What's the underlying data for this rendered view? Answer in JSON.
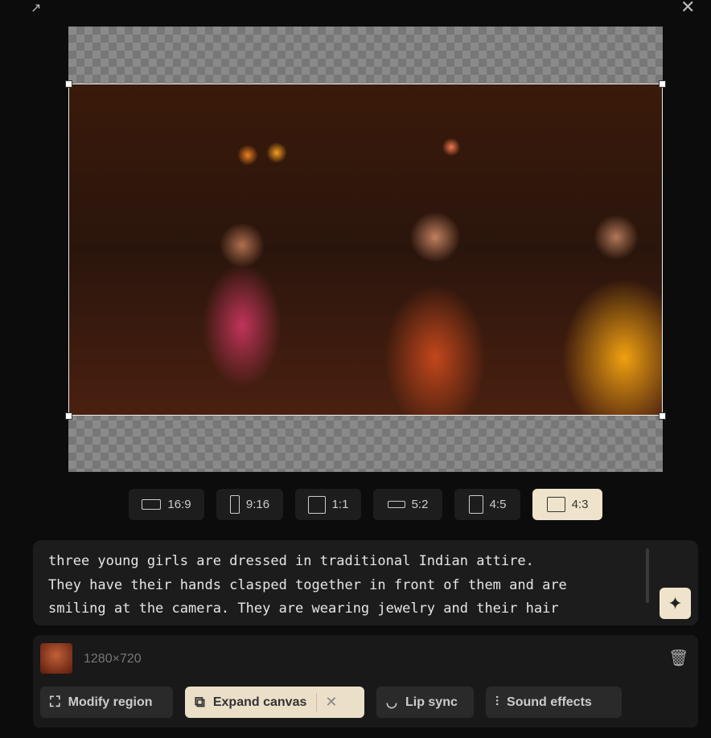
{
  "window": {
    "collapse_icon": "collapse-arrows-icon",
    "close_icon": "close-icon"
  },
  "aspect_ratios": [
    {
      "label": "16:9",
      "active": false
    },
    {
      "label": "9:16",
      "active": false
    },
    {
      "label": "1:1",
      "active": false
    },
    {
      "label": "5:2",
      "active": false
    },
    {
      "label": "4:5",
      "active": false
    },
    {
      "label": "4:3",
      "active": true
    }
  ],
  "prompt": {
    "text": "three young girls are dressed in traditional Indian attire.\nThey have their hands clasped together in front of them and are\nsmiling at the camera. They are wearing jewelry and their hair",
    "enhance_icon": "sparkle-icon"
  },
  "media": {
    "dimensions": "1280×720",
    "delete_icon": "trash-icon"
  },
  "tools": [
    {
      "label": "Modify region",
      "icon": "region-select-icon"
    },
    {
      "label": "Expand canvas",
      "icon": "expand-icon",
      "active": true
    },
    {
      "label": "Lip sync",
      "icon": "lips-icon"
    },
    {
      "label": "Sound effects",
      "icon": "sound-wave-icon"
    }
  ],
  "colors": {
    "accent": "#efe3cc",
    "background": "#0c0c0d"
  }
}
